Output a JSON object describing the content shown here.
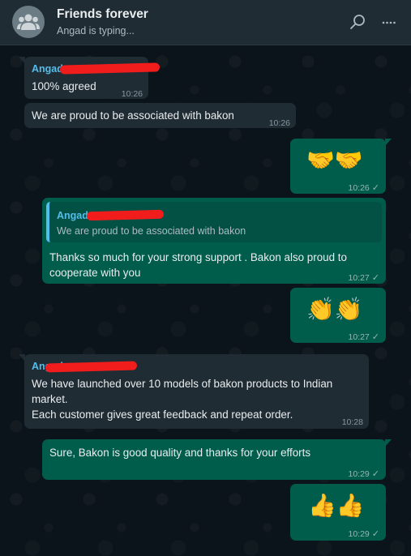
{
  "header": {
    "title": "Friends forever",
    "subtitle": "Angad is typing...",
    "icons": [
      "group-avatar-icon",
      "search-icon",
      "more-options-icon"
    ]
  },
  "messages": [
    {
      "direction": "in",
      "sender": "Angad",
      "text": "100% agreed",
      "time": "10:26"
    },
    {
      "direction": "in",
      "text": "We are proud to be associated with bakon",
      "time": "10:26"
    },
    {
      "direction": "out",
      "emoji": "🤝🤝",
      "time": "10:26",
      "tick": "✓"
    },
    {
      "direction": "out",
      "quote_sender": "Angad",
      "quote_text": "We are proud to be associated with bakon",
      "lines": [
        "Thanks so much for your strong support . Bakon also proud to",
        "cooperate with you"
      ],
      "time": "10:27",
      "tick": "✓"
    },
    {
      "direction": "out",
      "emoji": "👏👏",
      "time": "10:27",
      "tick": "✓"
    },
    {
      "direction": "in",
      "sender": "Angad",
      "lines": [
        "We have launched over 10 models of bakon products to Indian",
        "market.",
        "Each customer gives great feedback and repeat order."
      ],
      "time": "10:28"
    },
    {
      "direction": "out",
      "text": "Sure, Bakon is good quality and thanks for your efforts",
      "time": "10:29",
      "tick": "✓"
    },
    {
      "direction": "out",
      "emoji": "👍👍",
      "time": "10:29",
      "tick": "✓"
    }
  ],
  "colors": {
    "header_bg": "#202c33",
    "chat_bg": "#0b141a",
    "incoming_bubble": "#202c33",
    "outgoing_bubble": "#005c4b",
    "sender_name": "#53bdeb",
    "redaction": "#f11d1d"
  }
}
